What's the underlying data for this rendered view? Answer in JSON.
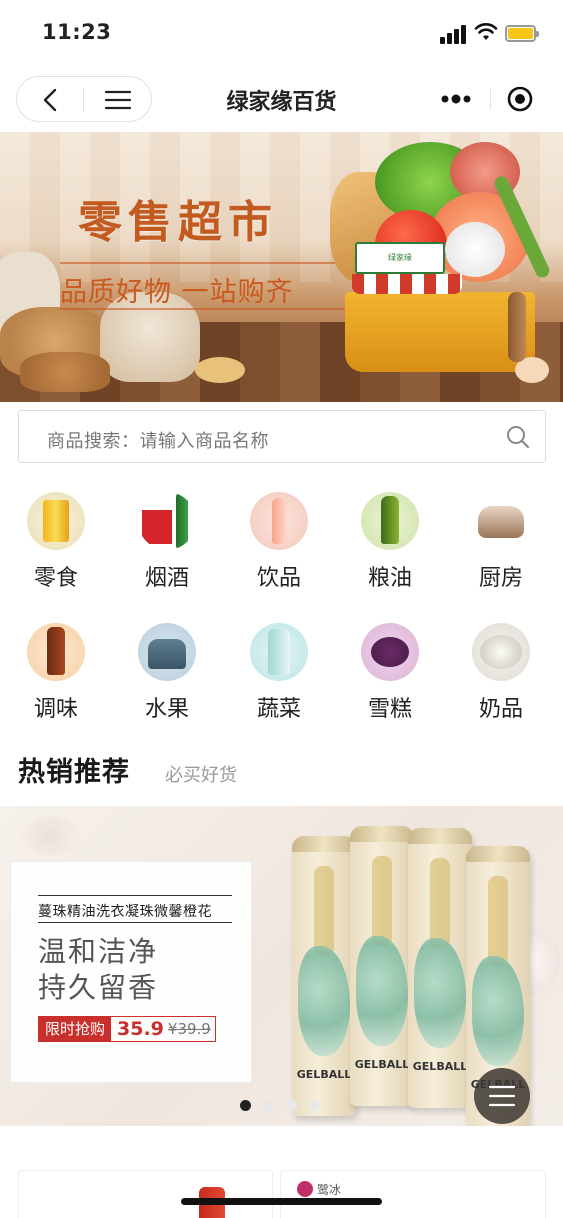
{
  "status_bar": {
    "time": "11:23"
  },
  "nav": {
    "title": "绿家缘百货"
  },
  "banner": {
    "title": "零售超市",
    "subtitle": "品质好物 一站购齐",
    "store_sign": "绿家缘"
  },
  "search": {
    "placeholder": "商品搜索：请输入商品名称"
  },
  "categories": [
    {
      "label": "零食",
      "icon": "snack-icon"
    },
    {
      "label": "烟酒",
      "icon": "liquor-icon"
    },
    {
      "label": "饮品",
      "icon": "drink-icon"
    },
    {
      "label": "粮油",
      "icon": "oil-icon"
    },
    {
      "label": "厨房",
      "icon": "kitchen-icon"
    },
    {
      "label": "调味",
      "icon": "seasoning-icon"
    },
    {
      "label": "水果",
      "icon": "fruit-icon"
    },
    {
      "label": "蔬菜",
      "icon": "vegetable-icon"
    },
    {
      "label": "雪糕",
      "icon": "icecream-icon"
    },
    {
      "label": "奶品",
      "icon": "dairy-icon"
    }
  ],
  "hot_section": {
    "title": "热销推荐",
    "subtitle": "必买好货"
  },
  "promo": {
    "product_name": "蔓珠精油洗衣凝珠微馨橙花",
    "headline_line1": "温和洁净",
    "headline_line2": "持久留香",
    "tag": "限时抢购",
    "price": "35.9",
    "old_price": "¥39.9",
    "can_brand": "GELBALL",
    "slide_count": 4,
    "active_slide": 1
  },
  "bottom_preview": {
    "brand_text": "鹭冰"
  },
  "colors": {
    "accent_red": "#c9302c",
    "banner_orange": "#c35a1f",
    "battery": "#f5c51a"
  }
}
